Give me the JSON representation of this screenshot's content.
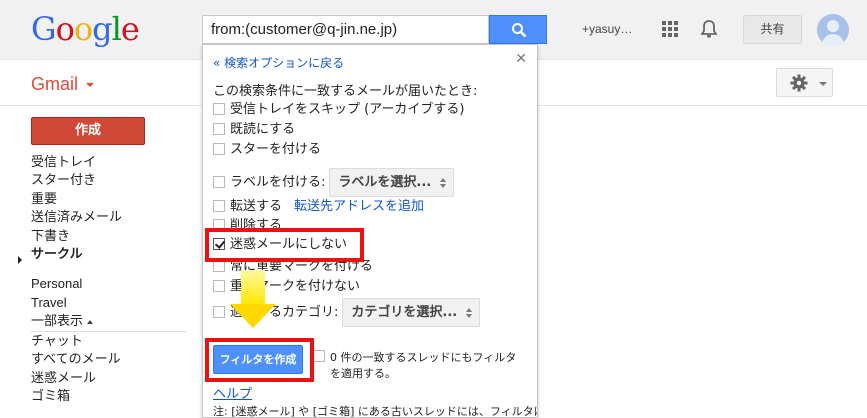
{
  "logo": {
    "text": "Google",
    "letters": [
      {
        "ch": "G",
        "color": "#3369e8"
      },
      {
        "ch": "o",
        "color": "#d50f25"
      },
      {
        "ch": "o",
        "color": "#eeb211"
      },
      {
        "ch": "g",
        "color": "#3369e8"
      },
      {
        "ch": "l",
        "color": "#009925"
      },
      {
        "ch": "e",
        "color": "#d50f25"
      }
    ]
  },
  "search": {
    "query": "from:(customer@q-jin.ne.jp)"
  },
  "header": {
    "user": "+yasuy…",
    "share_label": "共有"
  },
  "gmail": {
    "label": "Gmail"
  },
  "sidebar": {
    "compose_label": "作成",
    "items": [
      {
        "label": "受信トレイ"
      },
      {
        "label": "スター付き"
      },
      {
        "label": "重要"
      },
      {
        "label": "送信済みメール"
      },
      {
        "label": "下書き"
      },
      {
        "label": "サークル"
      }
    ],
    "circles": [
      {
        "label": "Personal"
      },
      {
        "label": "Travel"
      }
    ],
    "collapse_label": "一部表示",
    "more": [
      {
        "label": "チャット"
      },
      {
        "label": "すべてのメール"
      },
      {
        "label": "迷惑メール"
      },
      {
        "label": "ゴミ箱"
      }
    ]
  },
  "filter": {
    "back_label": "« 検索オプションに戻る",
    "lead": "この検索条件に一致するメールが届いたとき:",
    "options": [
      {
        "label": "受信トレイをスキップ (アーカイブする)",
        "checked": false
      },
      {
        "label": "既読にする",
        "checked": false
      },
      {
        "label": "スターを付ける",
        "checked": false
      },
      {
        "label": "ラベルを付ける:",
        "checked": false
      },
      {
        "label": "転送する",
        "checked": false
      },
      {
        "label": "削除する",
        "checked": false
      },
      {
        "label": "迷惑メールにしない",
        "checked": true
      },
      {
        "label": "常に重要マークを付ける",
        "checked": false
      },
      {
        "label": "重要マークを付けない",
        "checked": false
      },
      {
        "label": "適用するカテゴリ:",
        "checked": false
      }
    ],
    "label_select": "ラベルを選択...",
    "forward_link": "転送先アドレスを追加",
    "category_select": "カテゴリを選択...",
    "create_label": "フィルタを作成",
    "apply_text": "0 件の一致するスレッドにもフィルタを適用する。",
    "help_label": "ヘルプ",
    "note": "注: [迷惑メール] や [ゴミ箱] にある古いスレッドには、フィルタは"
  },
  "colors": {
    "highlight": "#ee1111",
    "arrow": "#ffd800",
    "accent": "#4d90fe",
    "compose": "#d14836"
  }
}
